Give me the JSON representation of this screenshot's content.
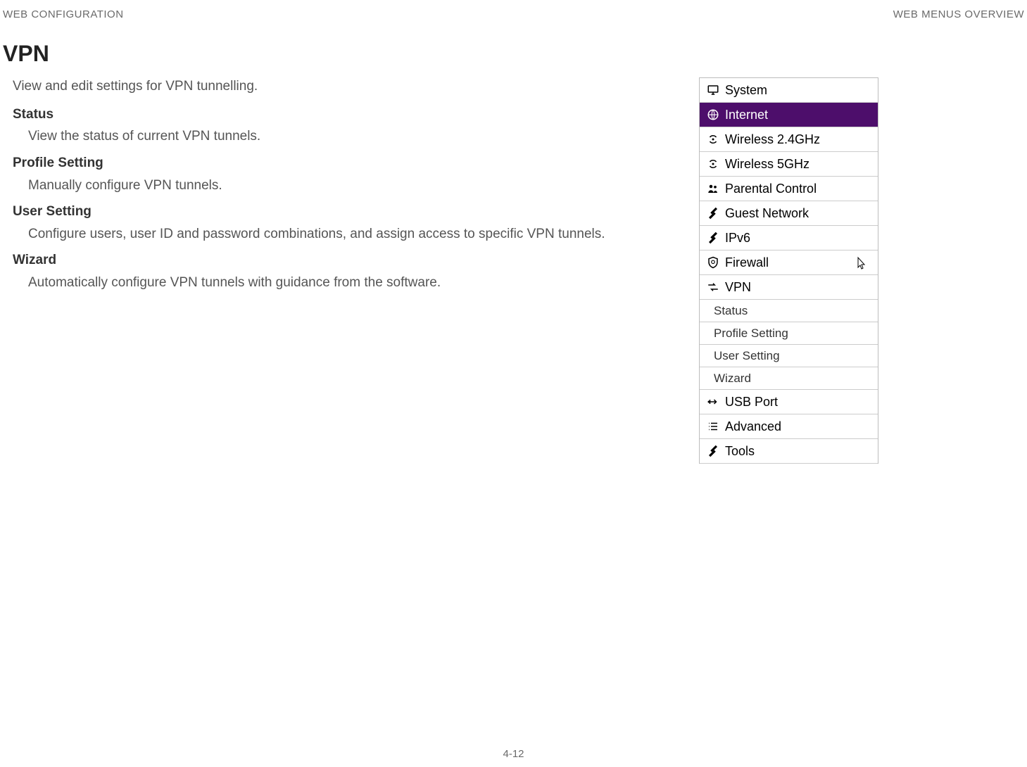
{
  "header": {
    "left": "WEB CONFIGURATION",
    "right": "WEB MENUS OVERVIEW"
  },
  "section": {
    "title": "VPN",
    "intro": "View and edit settings for VPN tunnelling.",
    "items": [
      {
        "heading": "Status",
        "desc": "View the status of current VPN tunnels."
      },
      {
        "heading": "Profile Setting",
        "desc": "Manually configure VPN tunnels."
      },
      {
        "heading": "User Setting",
        "desc": "Configure users, user ID and password combinations, and assign access to specific VPN tunnels."
      },
      {
        "heading": "Wizard",
        "desc": "Automatically configure VPN tunnels with guidance from the software."
      }
    ]
  },
  "menu": {
    "items": [
      {
        "icon": "monitor",
        "label": "System"
      },
      {
        "icon": "globe",
        "label": "Internet",
        "selected": true
      },
      {
        "icon": "signal",
        "label": "Wireless 2.4GHz"
      },
      {
        "icon": "signal",
        "label": "Wireless 5GHz"
      },
      {
        "icon": "people",
        "label": "Parental Control"
      },
      {
        "icon": "tools",
        "label": "Guest Network"
      },
      {
        "icon": "tools",
        "label": "IPv6"
      },
      {
        "icon": "shield",
        "label": "Firewall",
        "cursor": true
      },
      {
        "icon": "arrows",
        "label": "VPN"
      }
    ],
    "subitems": [
      {
        "label": "Status"
      },
      {
        "label": "Profile Setting"
      },
      {
        "label": "User Setting"
      },
      {
        "label": "Wizard"
      }
    ],
    "items_after": [
      {
        "icon": "usb",
        "label": "USB Port"
      },
      {
        "icon": "list",
        "label": "Advanced"
      },
      {
        "icon": "tools",
        "label": "Tools"
      }
    ]
  },
  "footer": {
    "page": "4-12"
  }
}
